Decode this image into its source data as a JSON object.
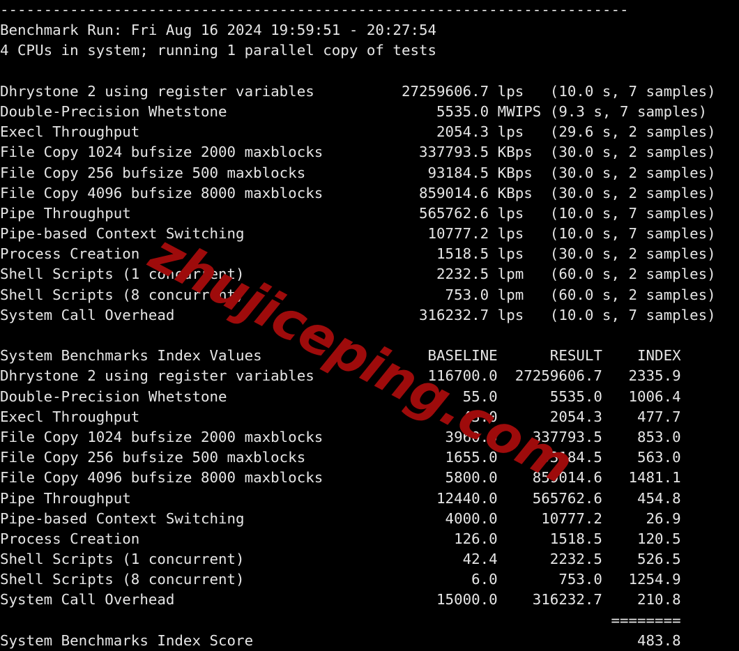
{
  "terminal": {
    "background_color": "#000000",
    "text_color": "#e6e6e6",
    "separator_line": "------------------------------------------------------------------------",
    "run_header": "Benchmark Run: Fri Aug 16 2024 19:59:51 - 20:27:54",
    "cpu_line": "4 CPUs in system; running 1 parallel copy of tests",
    "index_score_separator": "========",
    "index_score_label": "System Benchmarks Index Score",
    "index_score_value": "483.8"
  },
  "watermark": {
    "text": "zhujiceping.com",
    "color": "#9e0b0b"
  },
  "raw_results": {
    "rows": [
      {
        "name": "Dhrystone 2 using register variables",
        "value": "27259606.7",
        "unit": "lps",
        "detail": "(10.0 s, 7 samples)"
      },
      {
        "name": "Double-Precision Whetstone",
        "value": "5535.0",
        "unit": "MWIPS",
        "detail": "(9.3 s, 7 samples)"
      },
      {
        "name": "Execl Throughput",
        "value": "2054.3",
        "unit": "lps",
        "detail": "(29.6 s, 2 samples)"
      },
      {
        "name": "File Copy 1024 bufsize 2000 maxblocks",
        "value": "337793.5",
        "unit": "KBps",
        "detail": "(30.0 s, 2 samples)"
      },
      {
        "name": "File Copy 256 bufsize 500 maxblocks",
        "value": "93184.5",
        "unit": "KBps",
        "detail": "(30.0 s, 2 samples)"
      },
      {
        "name": "File Copy 4096 bufsize 8000 maxblocks",
        "value": "859014.6",
        "unit": "KBps",
        "detail": "(30.0 s, 2 samples)"
      },
      {
        "name": "Pipe Throughput",
        "value": "565762.6",
        "unit": "lps",
        "detail": "(10.0 s, 7 samples)"
      },
      {
        "name": "Pipe-based Context Switching",
        "value": "10777.2",
        "unit": "lps",
        "detail": "(10.0 s, 7 samples)"
      },
      {
        "name": "Process Creation",
        "value": "1518.5",
        "unit": "lps",
        "detail": "(30.0 s, 2 samples)"
      },
      {
        "name": "Shell Scripts (1 concurrent)",
        "value": "2232.5",
        "unit": "lpm",
        "detail": "(60.0 s, 2 samples)"
      },
      {
        "name": "Shell Scripts (8 concurrent)",
        "value": "753.0",
        "unit": "lpm",
        "detail": "(60.0 s, 2 samples)"
      },
      {
        "name": "System Call Overhead",
        "value": "316232.7",
        "unit": "lps",
        "detail": "(10.0 s, 7 samples)"
      }
    ]
  },
  "index_values": {
    "title": "System Benchmarks Index Values",
    "headers": {
      "baseline": "BASELINE",
      "result": "RESULT",
      "index": "INDEX"
    },
    "rows": [
      {
        "name": "Dhrystone 2 using register variables",
        "baseline": "116700.0",
        "result": "27259606.7",
        "index": "2335.9"
      },
      {
        "name": "Double-Precision Whetstone",
        "baseline": "55.0",
        "result": "5535.0",
        "index": "1006.4"
      },
      {
        "name": "Execl Throughput",
        "baseline": "43.0",
        "result": "2054.3",
        "index": "477.7"
      },
      {
        "name": "File Copy 1024 bufsize 2000 maxblocks",
        "baseline": "3960.0",
        "result": "337793.5",
        "index": "853.0"
      },
      {
        "name": "File Copy 256 bufsize 500 maxblocks",
        "baseline": "1655.0",
        "result": "93184.5",
        "index": "563.0"
      },
      {
        "name": "File Copy 4096 bufsize 8000 maxblocks",
        "baseline": "5800.0",
        "result": "859014.6",
        "index": "1481.1"
      },
      {
        "name": "Pipe Throughput",
        "baseline": "12440.0",
        "result": "565762.6",
        "index": "454.8"
      },
      {
        "name": "Pipe-based Context Switching",
        "baseline": "4000.0",
        "result": "10777.2",
        "index": "26.9"
      },
      {
        "name": "Process Creation",
        "baseline": "126.0",
        "result": "1518.5",
        "index": "120.5"
      },
      {
        "name": "Shell Scripts (1 concurrent)",
        "baseline": "42.4",
        "result": "2232.5",
        "index": "526.5"
      },
      {
        "name": "Shell Scripts (8 concurrent)",
        "baseline": "6.0",
        "result": "753.0",
        "index": "1254.9"
      },
      {
        "name": "System Call Overhead",
        "baseline": "15000.0",
        "result": "316232.7",
        "index": "210.8"
      }
    ]
  }
}
